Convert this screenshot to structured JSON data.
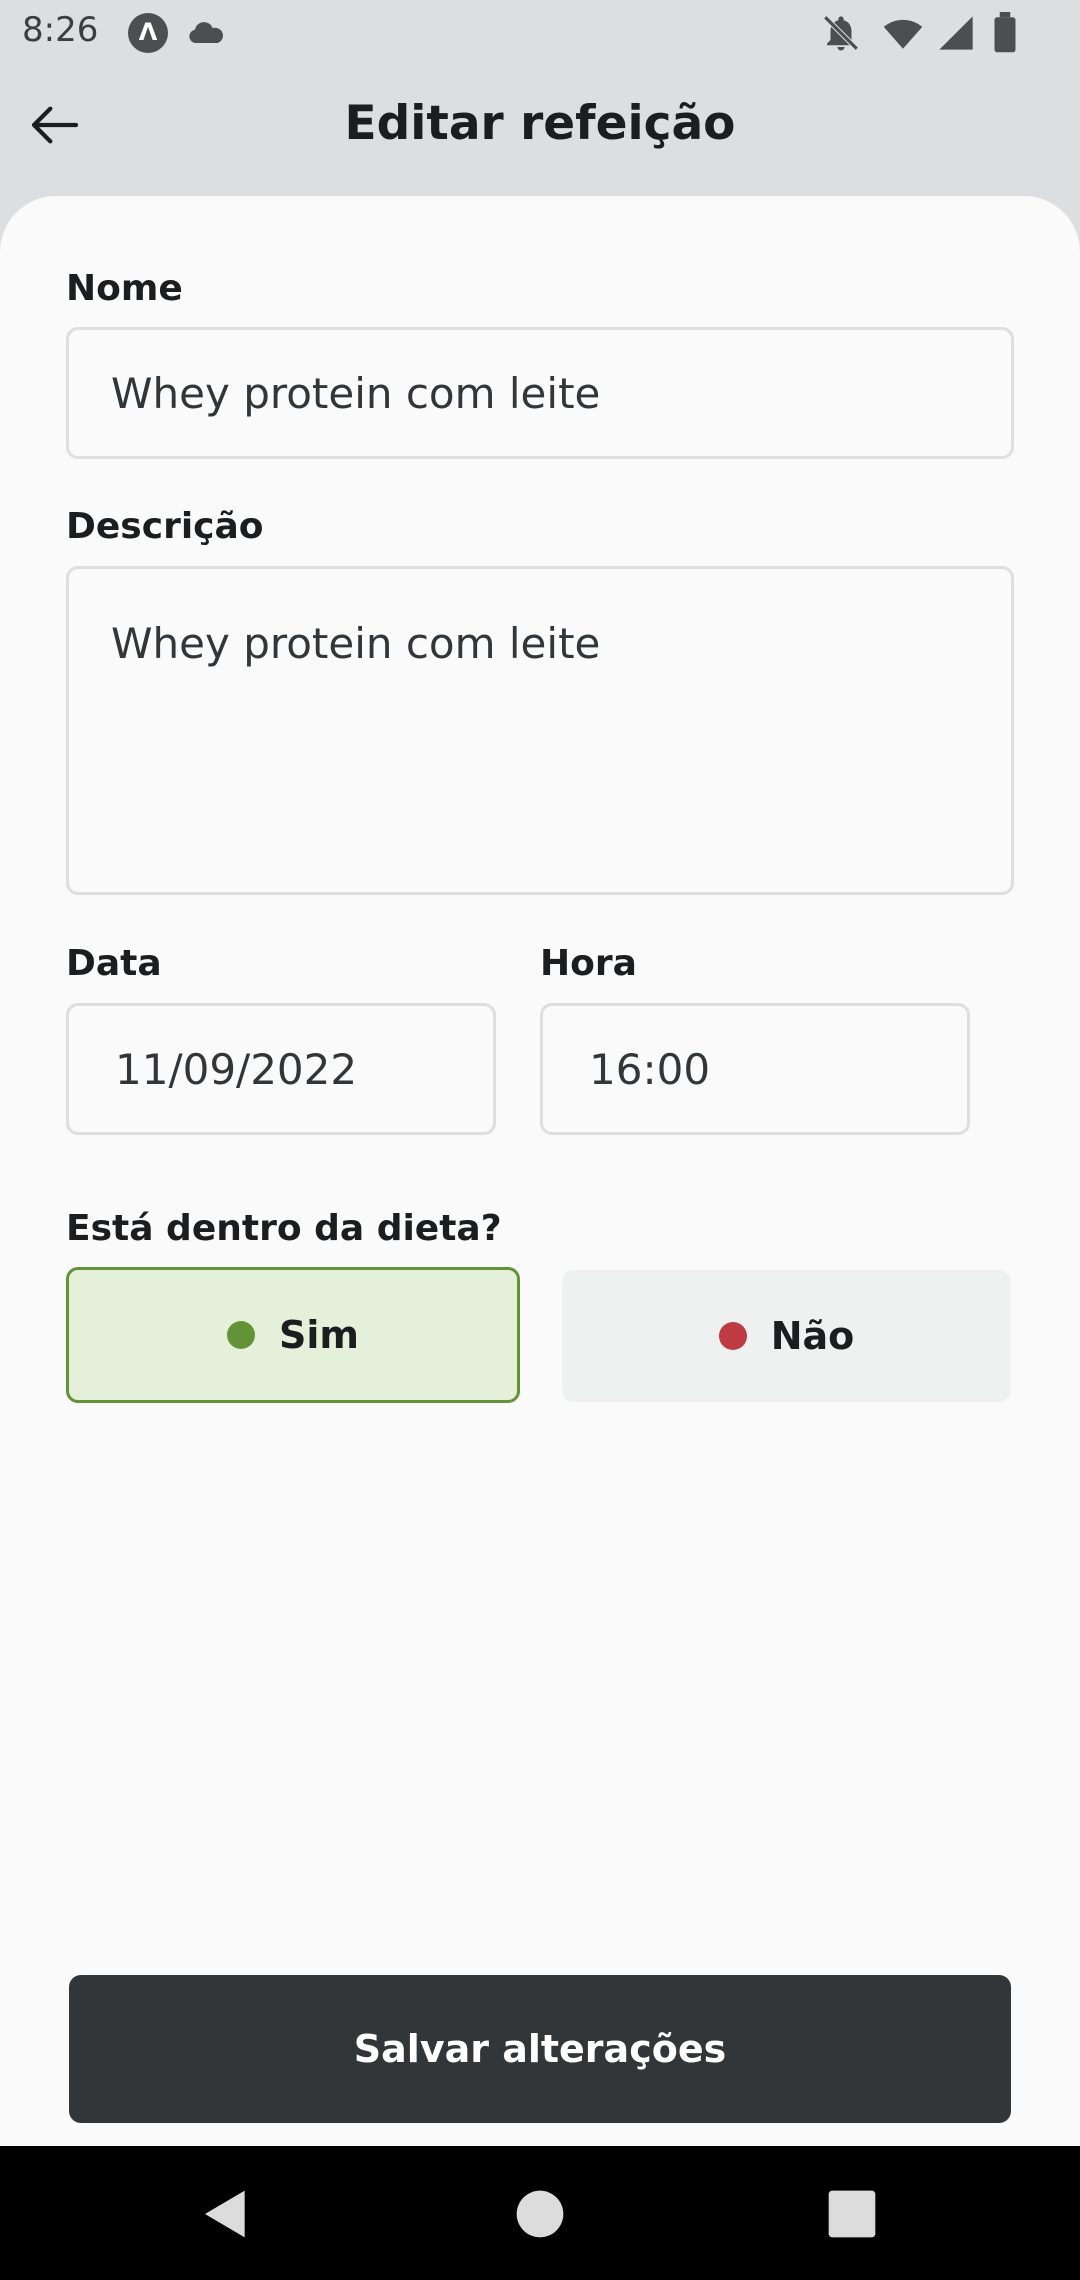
{
  "status_bar": {
    "time": "8:26",
    "app_icon_glyph": "Λ",
    "icons": [
      "cloud-icon",
      "notifications-off-icon",
      "wifi-icon",
      "signal-icon",
      "battery-icon"
    ]
  },
  "header": {
    "title": "Editar refeição",
    "back_icon": "arrow-left-icon"
  },
  "form": {
    "name_label": "Nome",
    "name_value": "Whey protein com leite",
    "description_label": "Descrição",
    "description_value": "Whey protein com leite",
    "date_label": "Data",
    "date_value": "11/09/2022",
    "time_label": "Hora",
    "time_value": "16:00",
    "diet_question": "Está dentro da dieta?",
    "diet_yes_label": "Sim",
    "diet_no_label": "Não",
    "diet_selected": "yes"
  },
  "save_button_label": "Salvar alterações",
  "colors": {
    "yes_dot": "#639339",
    "no_dot": "#bf3b44",
    "button_dark": "#333638"
  },
  "nav": [
    "back-icon",
    "home-icon",
    "recents-icon"
  ]
}
